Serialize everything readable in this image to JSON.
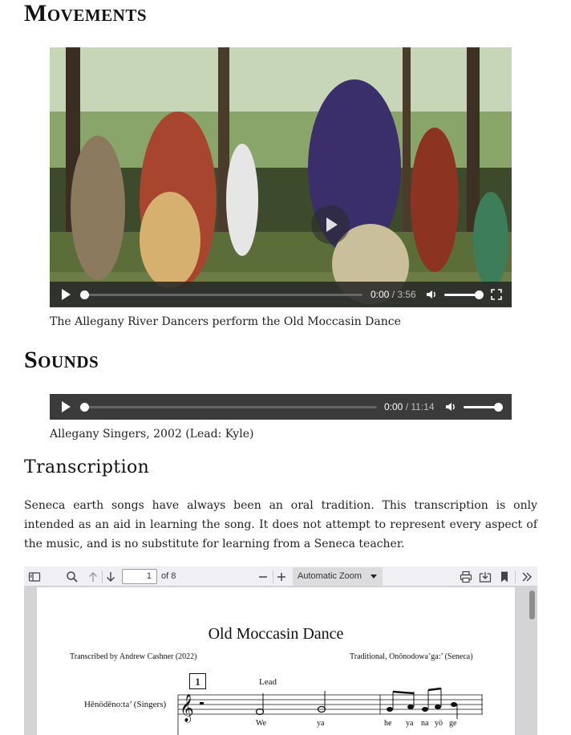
{
  "sections": {
    "movements_heading": "Movements",
    "sounds_heading": "Sounds",
    "transcription_heading": "Transcription"
  },
  "video": {
    "current_time": "0:00",
    "separator": " / ",
    "duration": "3:56",
    "caption": "The Allegany River Dancers perform the Old Moccasin Dance",
    "progress": 0,
    "volume": 1.0
  },
  "audio": {
    "current_time": "0:00",
    "separator": " / ",
    "duration": "11:14",
    "caption": "Allegany Singers, 2002 (Lead: Kyle)",
    "progress": 0,
    "volume": 1.0
  },
  "transcription": {
    "paragraph": "Seneca earth songs have always been an oral tradition. This transcription is only intended as an aid in learning the song. It does not attempt to represent every aspect of the music, and is no substitute for learning from a Seneca teacher."
  },
  "pdf_viewer": {
    "page_number": "1",
    "page_count_label": "of 8",
    "zoom_label": "Automatic Zoom",
    "icons": [
      "sidebar-toggle-icon",
      "search-icon",
      "arrow-up-icon",
      "arrow-down-icon",
      "zoom-out-icon",
      "zoom-in-icon",
      "print-icon",
      "download-icon",
      "bookmark-icon",
      "more-tools-icon"
    ]
  },
  "score": {
    "title": "Old Moccasin Dance",
    "transcriber": "Transcribed by Andrew Cashner (2022)",
    "attribution": "Traditional, Onōnodowa’ga:’ (Seneca)",
    "rehearsal_mark": "1",
    "lead_label": "Lead",
    "part_name": "Hēnödēno:ta’ (Singers)",
    "lyrics": [
      "We",
      "ya",
      "he",
      "ya",
      "na",
      "yö",
      "ge"
    ]
  }
}
